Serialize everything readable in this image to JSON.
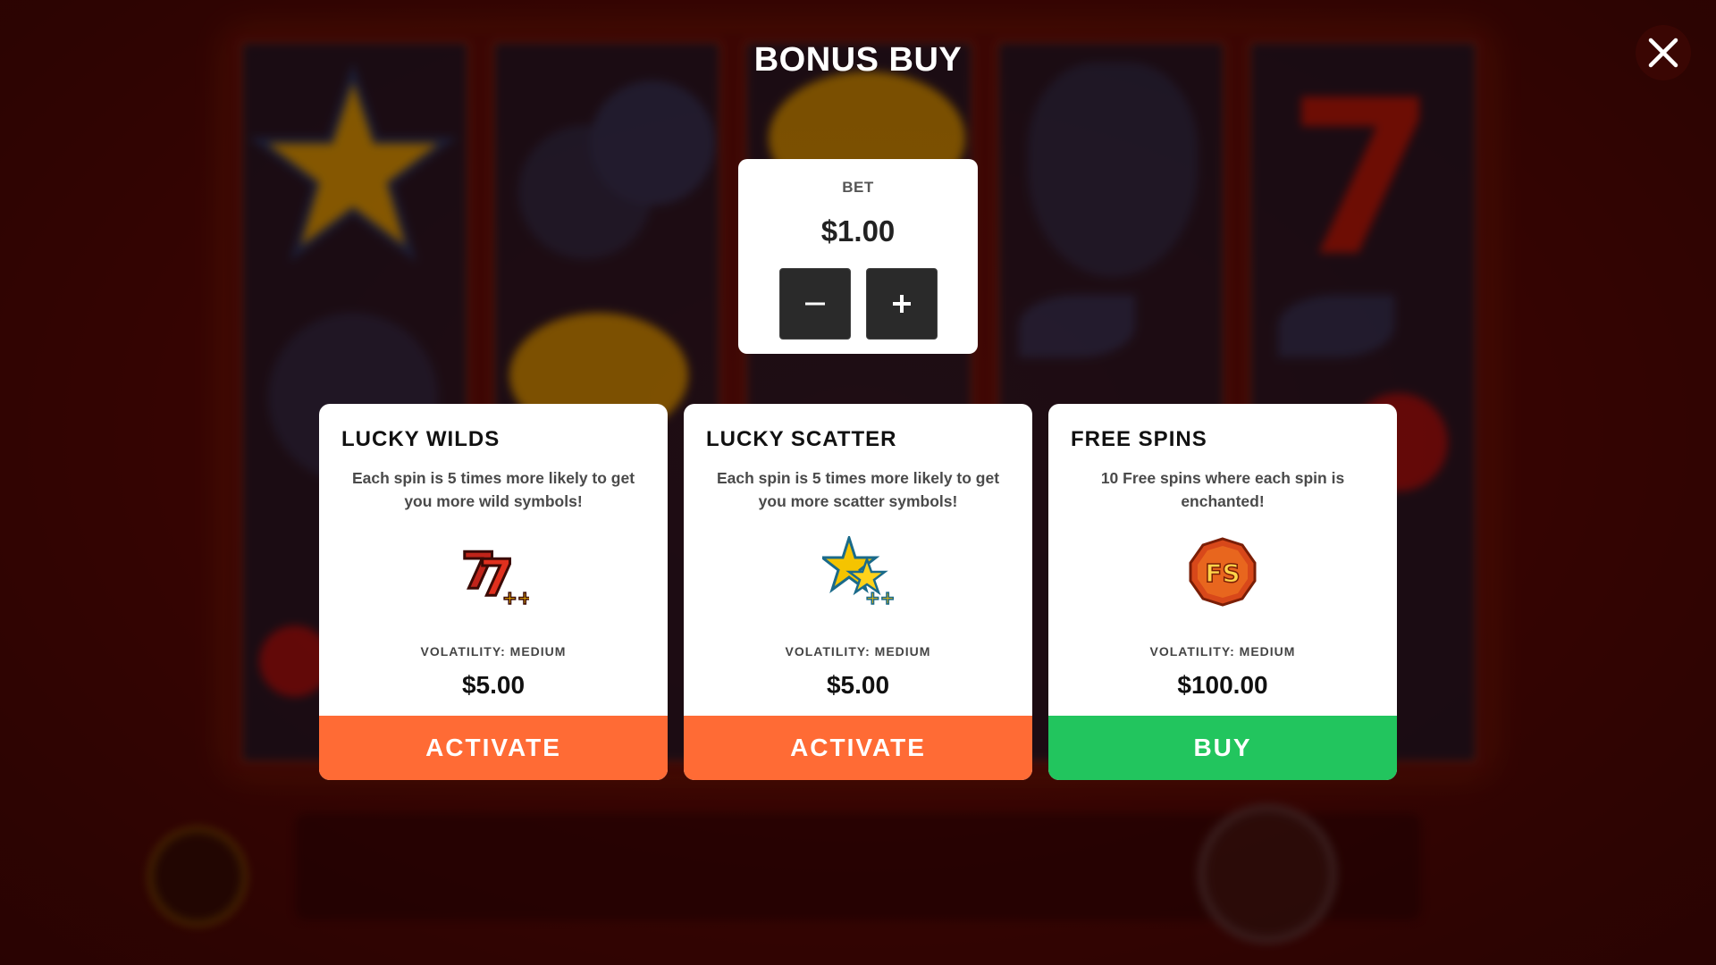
{
  "modal": {
    "title": "BONUS BUY"
  },
  "bet": {
    "label": "BET",
    "value": "$1.00",
    "decrease_icon": "minus-icon",
    "increase_icon": "plus-icon"
  },
  "close_icon": "close-icon",
  "options": [
    {
      "title": "LUCKY WILDS",
      "description": "Each spin is 5 times more likely to get you more wild symbols!",
      "icon": "lucky-sevens-icon",
      "volatility": "VOLATILITY: MEDIUM",
      "price": "$5.00",
      "action": "ACTIVATE",
      "action_color": "#ff6b35"
    },
    {
      "title": "LUCKY SCATTER",
      "description": "Each spin is 5 times more likely to get you more scatter symbols!",
      "icon": "lucky-stars-icon",
      "volatility": "VOLATILITY: MEDIUM",
      "price": "$5.00",
      "action": "ACTIVATE",
      "action_color": "#ff6b35"
    },
    {
      "title": "FREE SPINS",
      "description": "10 Free spins where each spin is enchanted!",
      "icon": "free-spins-badge-icon",
      "volatility": "VOLATILITY: MEDIUM",
      "price": "$100.00",
      "action": "BUY",
      "action_color": "#22c55e"
    }
  ],
  "colors": {
    "background": "#3d0603",
    "panel": "#ffffff",
    "activate": "#ff6b35",
    "buy": "#22c55e",
    "stepper": "#2a2a2a"
  }
}
